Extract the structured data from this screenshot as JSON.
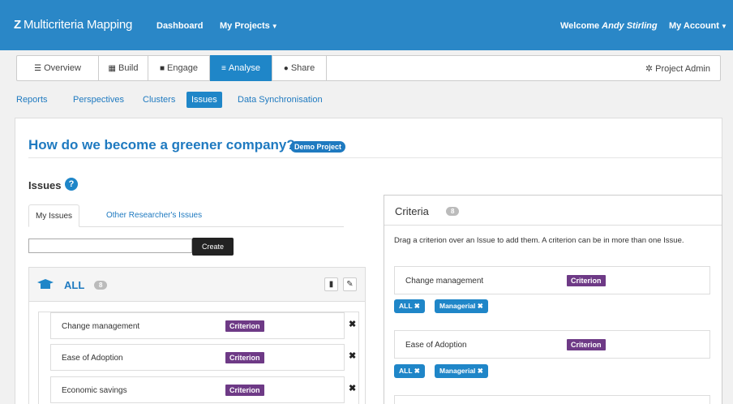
{
  "navbar": {
    "brand": "Multicriteria Mapping",
    "links": [
      "Dashboard",
      "My Projects"
    ],
    "welcome_prefix": "Welcome",
    "welcome_user": "Andy Stirling",
    "account": "My Account",
    "color": "#2a87c7"
  },
  "tabs": [
    {
      "label": "Overview",
      "icon": "list-icon"
    },
    {
      "label": "Build",
      "icon": "grid-icon"
    },
    {
      "label": "Engage",
      "icon": "comment-icon"
    },
    {
      "label": "Analyse",
      "icon": "align-icon",
      "active": true
    },
    {
      "label": "Share",
      "icon": "globe-icon"
    }
  ],
  "project_admin": "Project Admin",
  "subnav": [
    "Reports",
    "Perspectives",
    "Clusters",
    "Issues",
    "Data Synchronisation"
  ],
  "page": {
    "title": "How do we become a greener company?",
    "badge": "Demo Project",
    "section": "Issues"
  },
  "issue_tabs": [
    "My Issues",
    "Other Researcher's Issues"
  ],
  "create": {
    "value": "",
    "button": "Create"
  },
  "all_panel": {
    "title": "ALL",
    "count": "8",
    "items": [
      {
        "label": "Change management",
        "tag": "Criterion"
      },
      {
        "label": "Ease of Adoption",
        "tag": "Criterion"
      },
      {
        "label": "Economic savings",
        "tag": "Criterion"
      }
    ]
  },
  "criteria_panel": {
    "title": "Criteria",
    "count": "8",
    "hint": "Drag a criterion over an Issue to add them. A criterion can be in more than one Issue.",
    "items": [
      {
        "label": "Change management",
        "tag": "Criterion",
        "issues": [
          "ALL",
          "Managerial"
        ]
      },
      {
        "label": "Ease of Adoption",
        "tag": "Criterion",
        "issues": [
          "ALL",
          "Managerial"
        ]
      }
    ]
  },
  "colors": {
    "accent": "#1f86c8",
    "criterion": "#6e3a86",
    "badge_grey": "#bbbbbb"
  }
}
